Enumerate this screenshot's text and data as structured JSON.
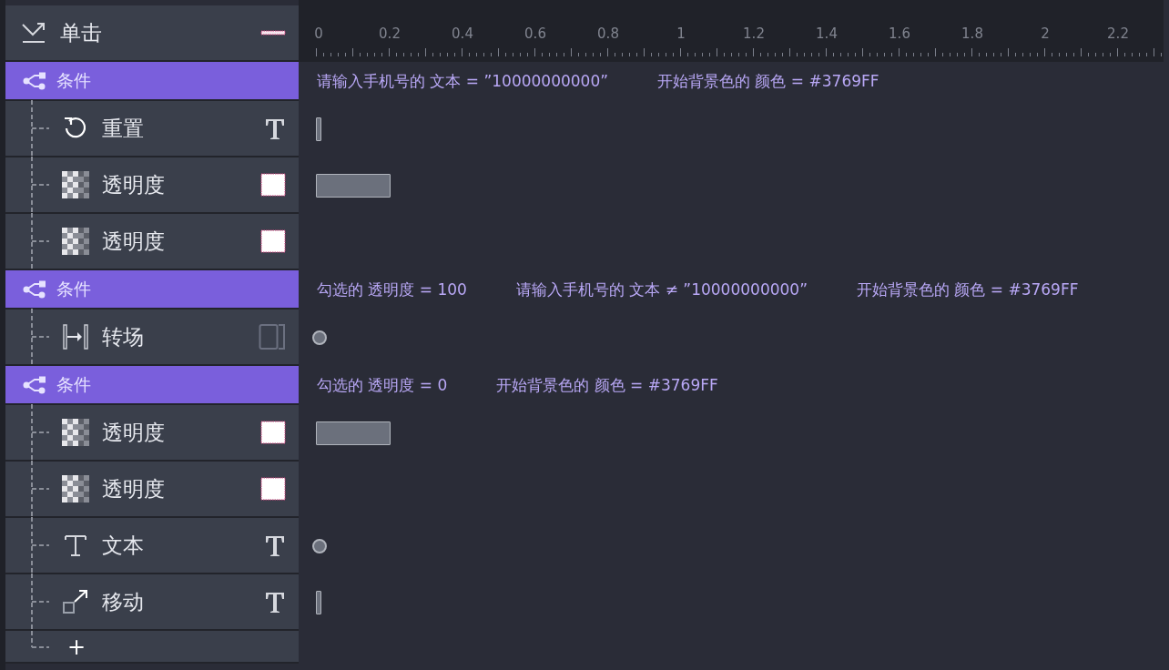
{
  "trigger": {
    "label": "单击",
    "end": {
      "kind": "dash"
    }
  },
  "ruler": {
    "ticks": [
      "0",
      "0.2",
      "0.4",
      "0.6",
      "0.8",
      "1",
      "1.2",
      "1.4",
      "1.6",
      "1.8",
      "2",
      "2.2"
    ]
  },
  "blocks": [
    {
      "label": "条件",
      "conditions": [
        "请输入手机号的 文本 = ”10000000000”",
        "开始背景色的 颜色 = #3769FF"
      ],
      "actions": [
        {
          "kind": "reset",
          "label": "重置",
          "end": {
            "kind": "type"
          },
          "track": {
            "kind": "tick"
          }
        },
        {
          "kind": "opacity",
          "label": "透明度",
          "end": {
            "kind": "swatch"
          },
          "track": {
            "kind": "bar"
          }
        },
        {
          "kind": "opacity",
          "label": "透明度",
          "end": {
            "kind": "swatch"
          }
        }
      ]
    },
    {
      "label": "条件",
      "conditions": [
        "勾选的 透明度 = 100",
        "请输入手机号的 文本 ≠ ”10000000000”",
        "开始背景色的 颜色 = #3769FF"
      ],
      "actions": [
        {
          "kind": "transition",
          "label": "转场",
          "end": {
            "kind": "frame"
          },
          "track": {
            "kind": "dot"
          }
        }
      ]
    },
    {
      "label": "条件",
      "conditions": [
        "勾选的 透明度 = 0",
        "开始背景色的 颜色 = #3769FF"
      ],
      "actions": [
        {
          "kind": "opacity",
          "label": "透明度",
          "end": {
            "kind": "swatch"
          },
          "track": {
            "kind": "bar"
          }
        },
        {
          "kind": "opacity",
          "label": "透明度",
          "end": {
            "kind": "swatch"
          }
        },
        {
          "kind": "text",
          "label": "文本",
          "end": {
            "kind": "type"
          },
          "track": {
            "kind": "dot"
          }
        },
        {
          "kind": "move",
          "label": "移动",
          "end": {
            "kind": "type"
          },
          "track": {
            "kind": "tick"
          }
        }
      ]
    }
  ],
  "add_button": "+"
}
